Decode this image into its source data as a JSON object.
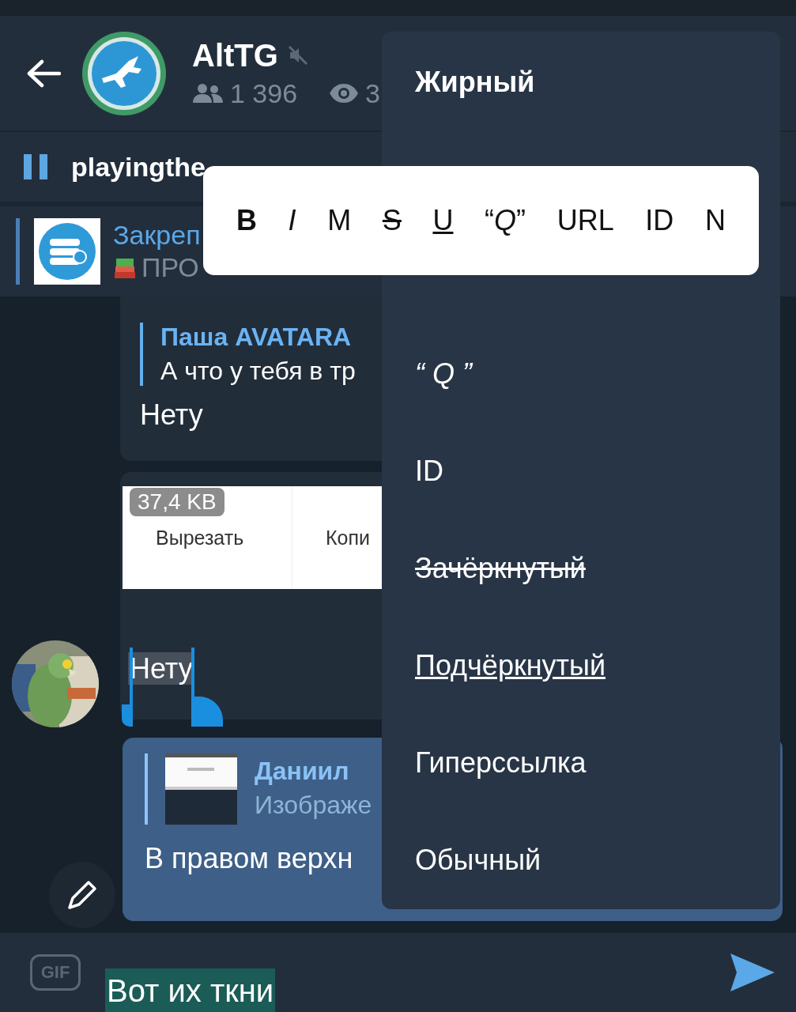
{
  "header": {
    "title": "AltTG",
    "muted": true,
    "members": "1 396",
    "views": "3"
  },
  "now_playing": {
    "title": "playingthe",
    "playing": true
  },
  "pinned": {
    "label": "Закреп",
    "preview": "ПРО"
  },
  "messages": [
    {
      "kind": "incoming",
      "has_avatar": false,
      "reply": {
        "author": "Паша AVATARA",
        "text": "А что у тебя в тр",
        "has_thumbnail": false
      },
      "text": "Нету",
      "text_selected": false
    },
    {
      "kind": "incoming",
      "has_avatar": true,
      "text": "Нету",
      "text_selected": true
    },
    {
      "kind": "outgoing",
      "has_avatar": false,
      "reply": {
        "author": "Даниил",
        "text": "Изображе",
        "has_thumbnail": true
      },
      "text": "В правом верхн",
      "text_selected": false
    }
  ],
  "clipboard_popup": {
    "size": "37,4 KB",
    "actions": [
      "Вырезать",
      "Копи"
    ]
  },
  "composer": {
    "gif_label": "GIF",
    "text": "Вот их ткни",
    "selected": true
  },
  "format_menu": {
    "items": [
      {
        "label": "Жирный",
        "kind": "bold"
      },
      {
        "label": "“ Q ”",
        "kind": "quote"
      },
      {
        "label": "ID",
        "kind": "plain"
      },
      {
        "label": "Зачёркнутый",
        "kind": "strike"
      },
      {
        "label": "Подчёркнутый",
        "kind": "underline"
      },
      {
        "label": "Гиперссылка",
        "kind": "plain"
      },
      {
        "label": "Обычный",
        "kind": "plain"
      }
    ]
  },
  "format_toolbar": {
    "items": [
      {
        "label": "B",
        "kind": "bold"
      },
      {
        "label": "I",
        "kind": "italic"
      },
      {
        "label": "M",
        "kind": "plain"
      },
      {
        "label": "S",
        "kind": "strike"
      },
      {
        "label": "U",
        "kind": "underline"
      },
      {
        "label": "“*Q*”",
        "kind": "plain"
      },
      {
        "label": "URL",
        "kind": "plain"
      },
      {
        "label": "ID",
        "kind": "plain"
      },
      {
        "label": "N",
        "kind": "plain"
      }
    ]
  }
}
